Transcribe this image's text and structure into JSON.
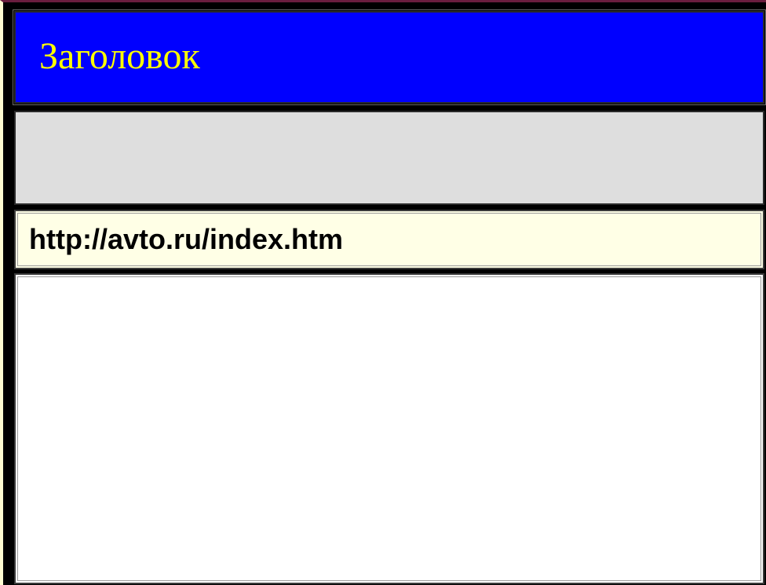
{
  "window": {
    "title": "Заголовок"
  },
  "address_bar": {
    "url": "http://avto.ru/index.htm"
  },
  "colors": {
    "title_bar_background": "#0000ff",
    "title_text": "#ffff00",
    "toolbar_background": "#dedede",
    "address_background": "#ffffe6",
    "content_background": "#ffffff",
    "frame": "#000000"
  }
}
